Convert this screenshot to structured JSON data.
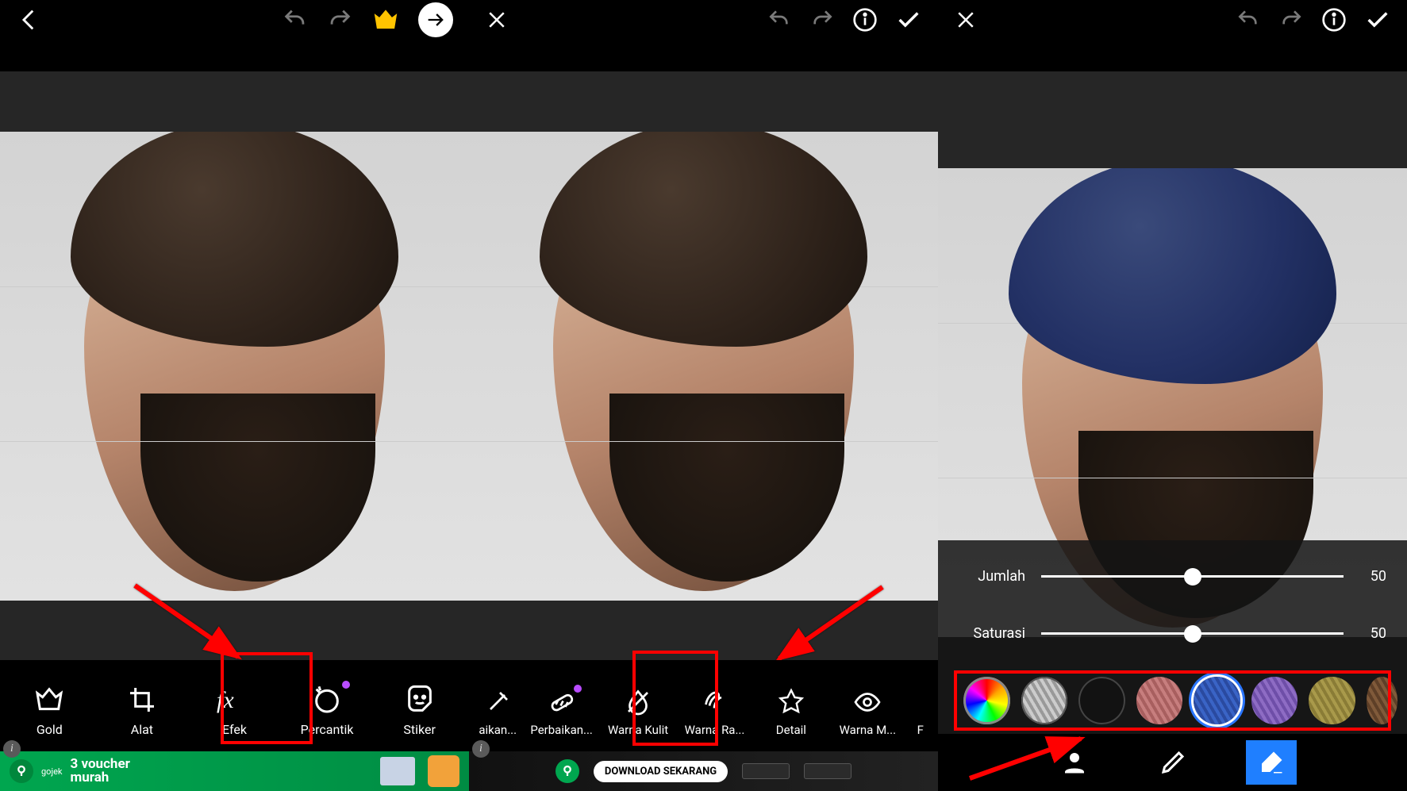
{
  "screen1": {
    "tools": [
      {
        "label": "Gold"
      },
      {
        "label": "Alat"
      },
      {
        "label": "Efek"
      },
      {
        "label": "Percantik"
      },
      {
        "label": "Stiker"
      }
    ],
    "ad": {
      "line1": "3 voucher",
      "line2": "murah",
      "brand": "gojek"
    }
  },
  "screen2": {
    "tools": [
      {
        "label": "aikan..."
      },
      {
        "label": "Perbaikan..."
      },
      {
        "label": "Warna Kulit"
      },
      {
        "label": "Warna Ra..."
      },
      {
        "label": "Detail"
      },
      {
        "label": "Warna M..."
      },
      {
        "label": "F"
      }
    ],
    "ad": {
      "download": "DOWNLOAD SEKARANG"
    }
  },
  "screen3": {
    "sliders": [
      {
        "label": "Jumlah",
        "value": "50",
        "pct": 50
      },
      {
        "label": "Saturasi",
        "value": "50",
        "pct": 50
      }
    ],
    "swatches": [
      {
        "name": "rainbow",
        "color": "rainbow"
      },
      {
        "name": "silver",
        "color": "stripes-silver"
      },
      {
        "name": "black",
        "color": "#111"
      },
      {
        "name": "pink",
        "color": "#c77e7e"
      },
      {
        "name": "blue",
        "color": "#3a64c6",
        "selected": true
      },
      {
        "name": "purple",
        "color": "#8e6cc4"
      },
      {
        "name": "olive",
        "color": "#a99a4b"
      },
      {
        "name": "brown",
        "color": "#805a3a"
      }
    ]
  }
}
